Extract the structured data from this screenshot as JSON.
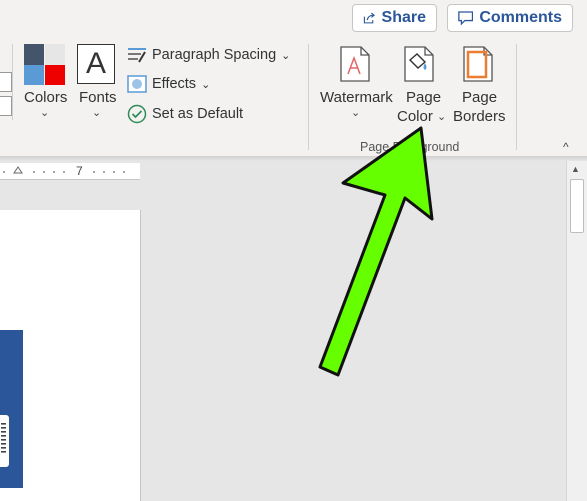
{
  "header": {
    "share_label": "Share",
    "comments_label": "Comments"
  },
  "ribbon": {
    "colors_label": "Colors",
    "fonts_label": "Fonts",
    "fonts_glyph": "A",
    "paragraph_spacing_label": "Paragraph Spacing",
    "effects_label": "Effects",
    "set_default_label": "Set as Default",
    "watermark_label": "Watermark",
    "page_color_line1": "Page",
    "page_color_line2": "Color",
    "page_borders_line1": "Page",
    "page_borders_line2": "Borders",
    "group_label": "Page Background",
    "chevron_down": "⌄",
    "collapse_glyph": "^"
  },
  "ruler": {
    "number": "7"
  },
  "scrollbar": {
    "up_glyph": "▲"
  },
  "colors": {
    "accent_blue": "#2b579a",
    "arrow_green": "#66ff00",
    "swatch_red": "#ee0000",
    "swatch_blue": "#5b9bd5",
    "swatch_dark": "#44546a"
  },
  "icons": [
    "share-icon",
    "comments-icon",
    "colors-icon",
    "fonts-icon",
    "paragraph-spacing-icon",
    "effects-icon",
    "checkmark-icon",
    "watermark-icon",
    "page-color-icon",
    "page-borders-icon"
  ]
}
